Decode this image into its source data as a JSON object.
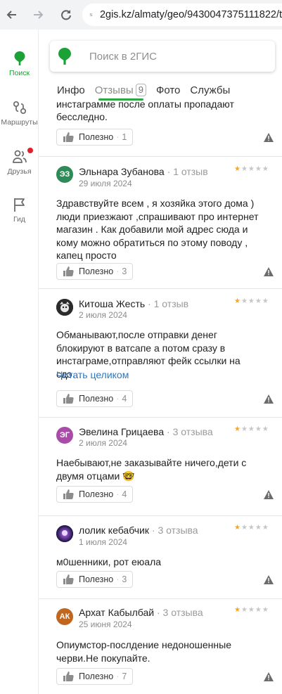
{
  "browser": {
    "url": "2gis.kz/almaty/geo/9430047375111822/t"
  },
  "sidebar": {
    "items": [
      {
        "label": "Поиск",
        "icon": "pin-icon",
        "active": true
      },
      {
        "label": "Маршруты",
        "icon": "route-icon"
      },
      {
        "label": "Друзья",
        "icon": "friends-icon",
        "notification": true
      },
      {
        "label": "Гид",
        "icon": "flag-icon"
      }
    ]
  },
  "search": {
    "placeholder": "Поиск в 2ГИС"
  },
  "tabs": [
    {
      "label": "Инфо"
    },
    {
      "label": "Отзывы",
      "count": "9",
      "active": true
    },
    {
      "label": "Фото"
    },
    {
      "label": "Службы"
    }
  ],
  "partial_review": {
    "text_line1": "инстаграмме после оплаты пропадают",
    "text_line2": "бесследно.",
    "useful_label": "Полезно",
    "useful_count": "1"
  },
  "reviews": [
    {
      "initials": "ЭЗ",
      "avatar_color": "#2e8b57",
      "name": "Эльнара Зубанова",
      "reviews_count": "1 отзыв",
      "date": "29 июля 2024",
      "rating": 1,
      "text": "Здравствуйте всем , я хозяйка этого дома ) люди приезжают ,спрашивают про интернет магазин . Как добавили мой адрес сюда и кому можно обратиться по этому поводу , капец просто",
      "useful_label": "Полезно",
      "useful_count": "3"
    },
    {
      "initials": "",
      "avatar_color": "#2b2b2b",
      "name": "Китоша Жесть",
      "reviews_count": "1 отзыв",
      "date": "2 июля 2024",
      "rating": 1,
      "text": "Обманывают,после отправки денег блокируют в ватсапе а потом сразу в инстаграме,отправляют фейк ссылки на сдэ…",
      "read_more": "Читать целиком",
      "useful_label": "Полезно",
      "useful_count": "4"
    },
    {
      "initials": "ЭГ",
      "avatar_color": "#a94ca8",
      "name": "Эвелина Грицаева",
      "reviews_count": "3 отзыва",
      "date": "2 июля 2024",
      "rating": 1,
      "text": "Наебывают,не заказывайте ничего,дети с двумя отцами 🤓",
      "useful_label": "Полезно",
      "useful_count": "4"
    },
    {
      "initials": "",
      "avatar_color": "#3b2a6e",
      "name": "лолик кебабчик",
      "reviews_count": "3 отзыва",
      "date": "1 июля 2024",
      "rating": 1,
      "text": "м0шенники, рот еюала",
      "useful_label": "Полезно",
      "useful_count": "3"
    },
    {
      "initials": "АК",
      "avatar_color": "#c0661f",
      "name": "Архат Кабылбай",
      "reviews_count": "3 отзыва",
      "date": "25 июня 2024",
      "rating": 1,
      "text": "Опиумстор-послдение недоношенные черви.Не покупайте.",
      "useful_label": "Полезно",
      "useful_count": "7"
    }
  ],
  "colors": {
    "brand_green": "#1ba136",
    "star_active": "#f5a623",
    "link_blue": "#2a79c9"
  }
}
